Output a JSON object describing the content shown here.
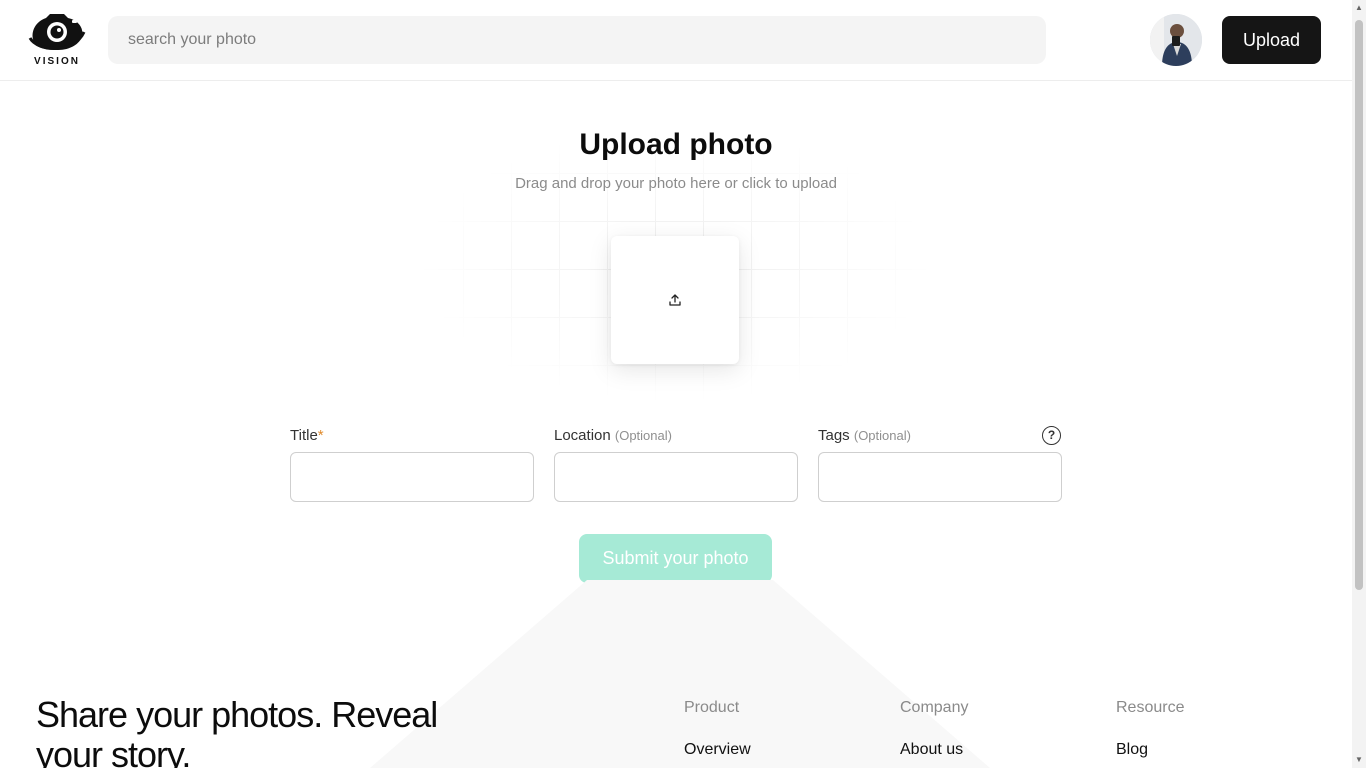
{
  "header": {
    "logo_text": "VISION",
    "search_placeholder": "search your photo",
    "upload_label": "Upload"
  },
  "upload": {
    "title": "Upload photo",
    "subtitle": "Drag and drop your photo here or click to upload",
    "dropzone_icon": "upload-icon"
  },
  "form": {
    "title_label": "Title",
    "title_required": "*",
    "location_label": "Location",
    "location_optional": "(Optional)",
    "tags_label": "Tags",
    "tags_optional": "(Optional)",
    "help_icon": "question-circle-icon",
    "help_glyph": "?",
    "submit_label": "Submit your photo"
  },
  "footer": {
    "tagline": "Share your photos. Reveal your story.",
    "columns": [
      {
        "heading": "Product",
        "first_link": "Overview"
      },
      {
        "heading": "Company",
        "first_link": "About us"
      },
      {
        "heading": "Resource",
        "first_link": "Blog"
      }
    ]
  },
  "colors": {
    "primary_button": "#151515",
    "submit_disabled": "#a6ead6",
    "required_mark": "#e08a2b"
  }
}
